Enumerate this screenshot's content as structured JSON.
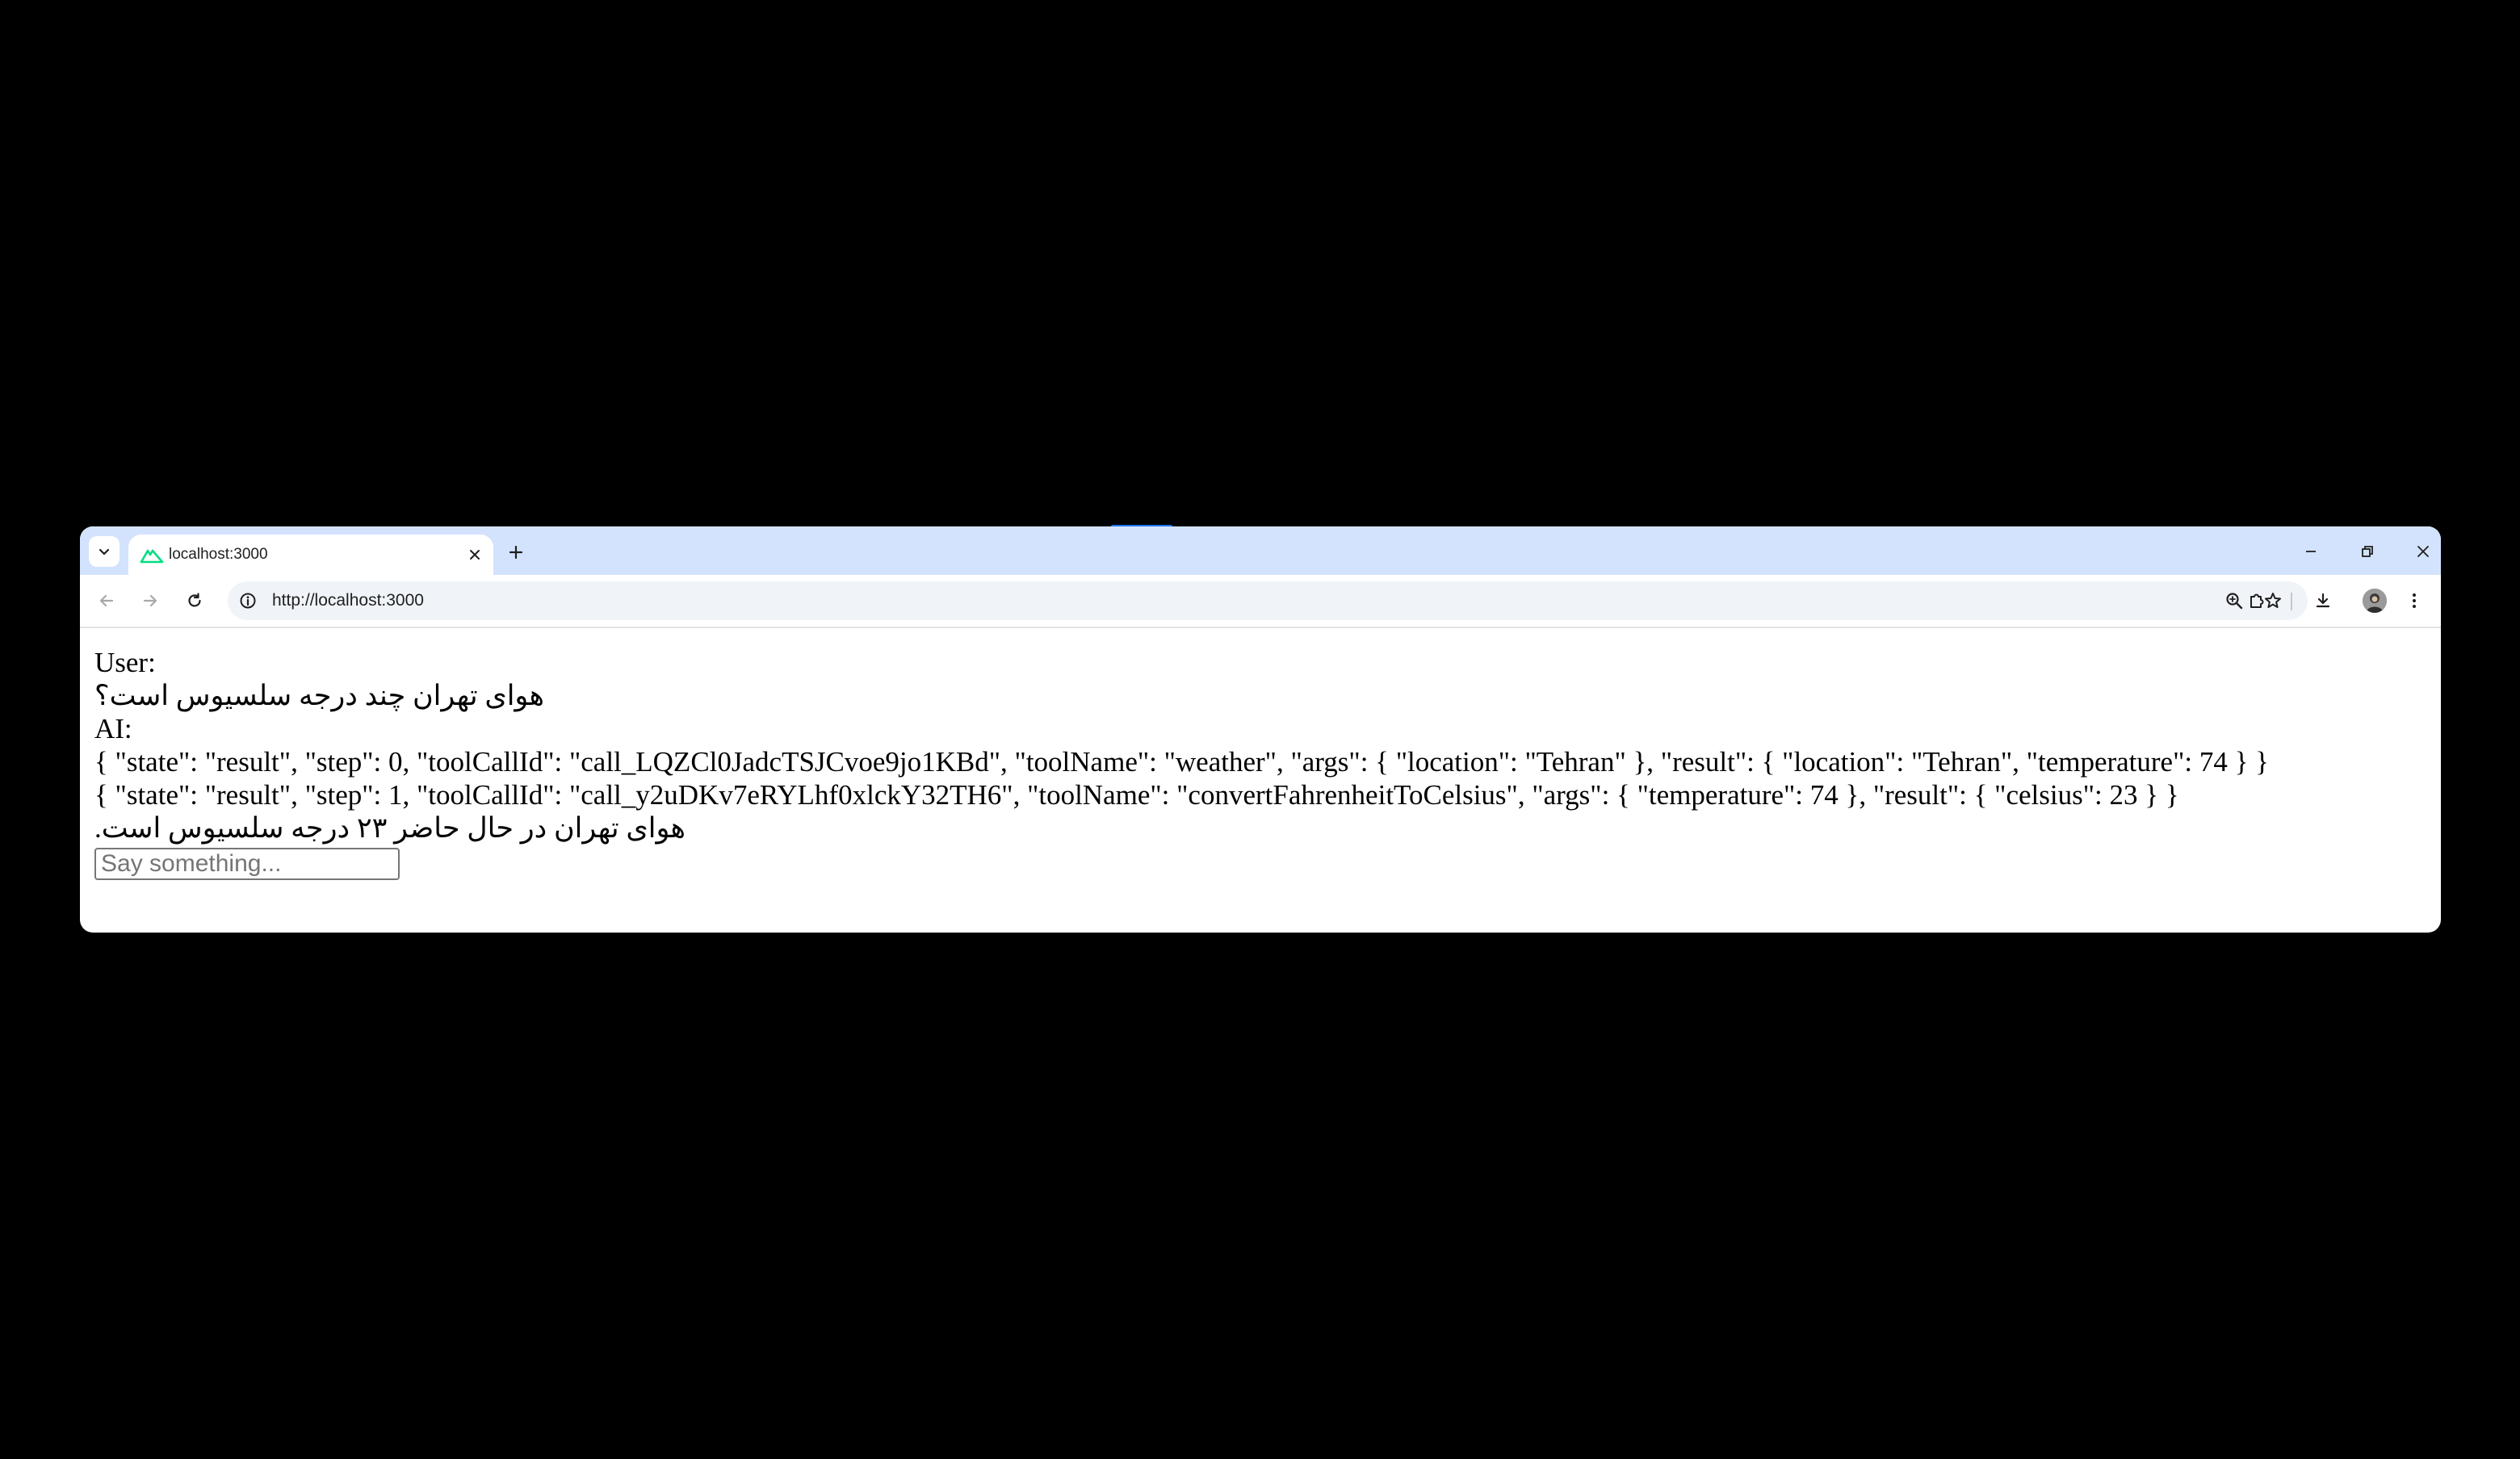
{
  "browser": {
    "tab": {
      "title": "localhost:3000",
      "favicon": "nuxt-icon"
    },
    "omnibox": {
      "url": "http://localhost:3000"
    },
    "icons": {
      "tab_search": "chevron-down-icon",
      "tab_close": "close-icon",
      "new_tab": "plus-icon",
      "minimize": "minimize-icon",
      "restore": "restore-icon",
      "close_window": "close-icon",
      "back": "arrow-left-icon",
      "forward": "arrow-right-icon",
      "reload": "reload-icon",
      "site_info": "info-icon",
      "zoom": "zoom-icon",
      "bookmark": "star-icon",
      "extensions": "puzzle-icon",
      "downloads": "download-icon",
      "menu": "more-vert-icon"
    },
    "colors": {
      "tabstrip": "#d3e3fd",
      "omnibox": "#f0f4f9",
      "favicon": "#00dc82"
    }
  },
  "page": {
    "messages": [
      {
        "role_label": "User:",
        "lines": [
          "هوای تهران چند درجه سلسیوس است؟"
        ]
      },
      {
        "role_label": "AI:",
        "lines": [
          "{ \"state\": \"result\", \"step\": 0, \"toolCallId\": \"call_LQZCl0JadcTSJCvoe9jo1KBd\", \"toolName\": \"weather\", \"args\": { \"location\": \"Tehran\" }, \"result\": { \"location\": \"Tehran\", \"temperature\": 74 } }",
          "{ \"state\": \"result\", \"step\": 1, \"toolCallId\": \"call_y2uDKv7eRYLhf0xlckY32TH6\", \"toolName\": \"convertFahrenheitToCelsius\", \"args\": { \"temperature\": 74 }, \"result\": { \"celsius\": 23 } }",
          "هوای تهران در حال حاضر ۲۳ درجه سلسیوس است."
        ]
      }
    ],
    "input": {
      "placeholder": "Say something...",
      "value": ""
    }
  }
}
